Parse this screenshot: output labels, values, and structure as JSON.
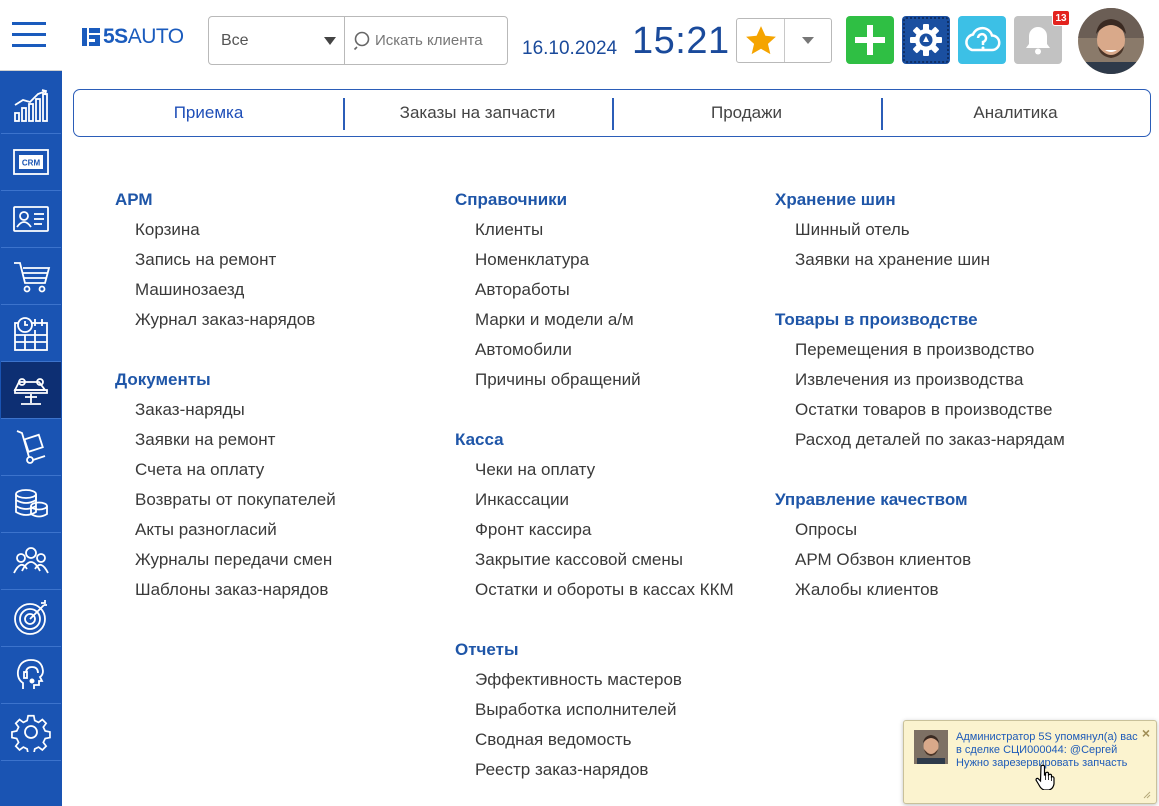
{
  "brand": {
    "logo_bold": "5S",
    "logo_rest": "AUTO"
  },
  "search": {
    "scope_value": "Все",
    "placeholder": "Искать клиента"
  },
  "clock": {
    "date": "16.10.2024",
    "time": "15:21"
  },
  "notifications": {
    "count": "13"
  },
  "colors": {
    "primary": "#1a54b3",
    "sidebar_active": "#0d2f73",
    "add_button": "#2fbf44",
    "settings_button": "#1a4fa0",
    "help_button": "#3cc0e6",
    "bell_button": "#c2c2c2",
    "badge": "#e3231e",
    "star": "#f5a400",
    "section_title": "#1f56a8"
  },
  "toolbar_icons": [
    "menu-icon",
    "star-icon",
    "plus-icon",
    "gear-icon",
    "help-cloud-icon",
    "bell-icon"
  ],
  "sidebar": {
    "icons": [
      "analytics-chart-icon",
      "crm-icon",
      "contact-card-icon",
      "shopping-cart-icon",
      "calendar-clock-icon",
      "car-lift-icon",
      "parts-cart-icon",
      "coins-stack-icon",
      "team-icon",
      "target-icon",
      "headset-icon",
      "settings-gear-icon"
    ],
    "crm_label": "CRM"
  },
  "tabs": [
    {
      "label": "Приемка",
      "active": true
    },
    {
      "label": "Заказы на запчасти",
      "active": false
    },
    {
      "label": "Продажи",
      "active": false
    },
    {
      "label": "Аналитика",
      "active": false
    }
  ],
  "columns": [
    {
      "sections": [
        {
          "title": "АРМ",
          "items": [
            "Корзина",
            "Запись на ремонт",
            "Машинозаезд",
            "Журнал заказ-нарядов"
          ]
        },
        {
          "title": "Документы",
          "items": [
            "Заказ-наряды",
            "Заявки на ремонт",
            "Счета на оплату",
            "Возвраты от покупателей",
            "Акты разногласий",
            "Журналы передачи смен",
            "Шаблоны заказ-нарядов"
          ]
        }
      ]
    },
    {
      "sections": [
        {
          "title": "Справочники",
          "items": [
            "Клиенты",
            "Номенклатура",
            "Автоработы",
            "Марки и модели а/м",
            "Автомобили",
            "Причины обращений"
          ]
        },
        {
          "title": "Касса",
          "items": [
            "Чеки на оплату",
            "Инкассации",
            "Фронт кассира",
            "Закрытие кассовой смены",
            "Остатки и обороты в кассах ККМ"
          ]
        },
        {
          "title": "Отчеты",
          "items": [
            "Эффективность мастеров",
            "Выработка исполнителей",
            "Сводная ведомость",
            "Реестр заказ-нарядов"
          ]
        }
      ]
    },
    {
      "sections": [
        {
          "title": "Хранение шин",
          "items": [
            "Шинный отель",
            "Заявки на хранение шин"
          ]
        },
        {
          "title": "Товары в производстве",
          "items": [
            "Перемещения в производство",
            "Извлечения из производства",
            "Остатки товаров в производстве",
            "Расход деталей по заказ-нарядам"
          ]
        },
        {
          "title": "Управление качеством",
          "items": [
            "Опросы",
            "АРМ Обзвон клиентов",
            "Жалобы клиентов"
          ]
        }
      ]
    }
  ],
  "notification_popup": {
    "message": "Администратор 5S упомянул(а) вас в сделке СЦИ000044: @Сергей Нужно зарезервировать запчасть",
    "close_symbol": "×"
  }
}
